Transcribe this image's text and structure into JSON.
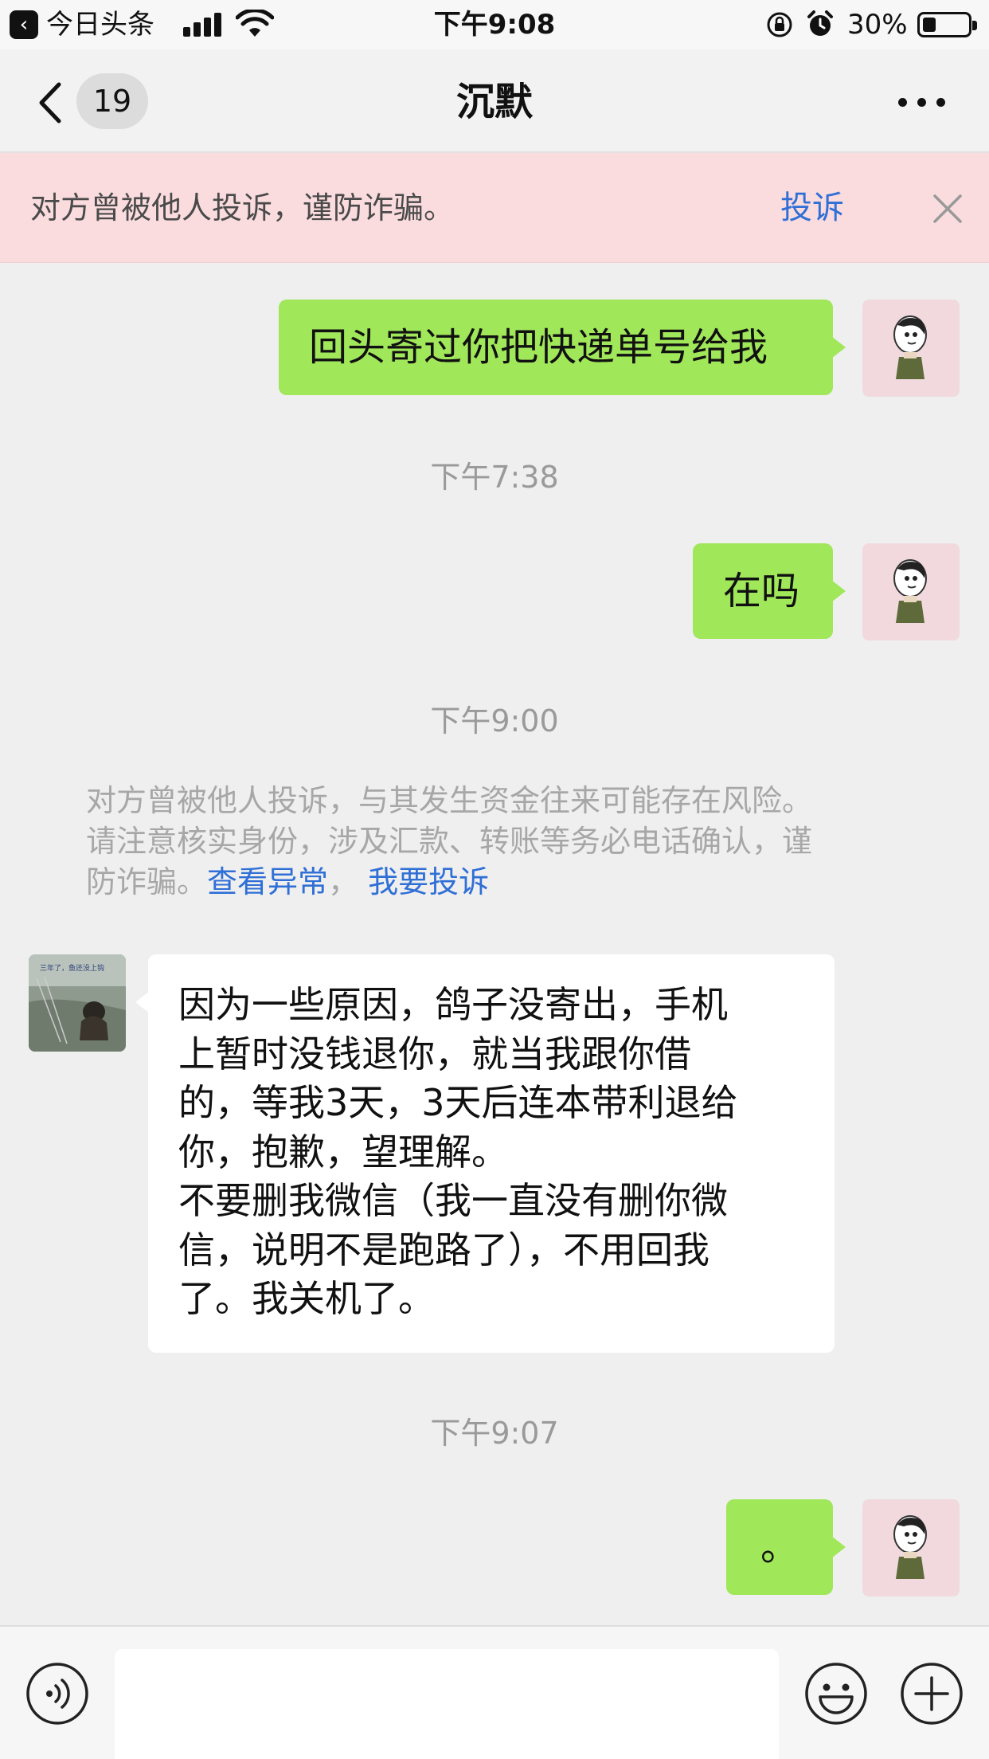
{
  "status_bar": {
    "back_app_label": "今日头条",
    "time": "下午9:08",
    "battery": "30%"
  },
  "nav": {
    "unread_count": "19",
    "title": "沉默"
  },
  "warning_banner": {
    "text": "对方曾被他人投诉，谨防诈骗。",
    "action": "投诉"
  },
  "messages": [
    {
      "type": "sent",
      "text": "回头寄过你把快递单号给我"
    },
    {
      "type": "timestamp",
      "text": "下午7:38"
    },
    {
      "type": "sent",
      "text": "在吗"
    },
    {
      "type": "timestamp",
      "text": "下午9:00"
    },
    {
      "type": "received",
      "lines": [
        "因为一些原因，鸽子没寄出，手机",
        "上暂时没钱退你，就当我跟你借",
        "的，等我3天，3天后连本带利退给",
        "你，抱歉，望理解。",
        "不要删我微信（我一直没有删你微",
        "信，说明不是跑路了），不用回我",
        "了。我关机了。"
      ]
    },
    {
      "type": "timestamp",
      "text": "下午9:07"
    },
    {
      "type": "sent",
      "text": "。"
    }
  ],
  "system_notice": {
    "line1": "对方曾被他人投诉，与其发生资金往来可能存在风险。",
    "line2": "请注意核实身份，涉及汇款、转账等务必电话确认，谨",
    "line3_prefix": "防诈骗。",
    "link_view": "查看异常",
    "separator": "，",
    "link_report": "我要投诉"
  },
  "avatar_caption": "三年了，鱼还没上钩",
  "colors": {
    "sent_bubble": "#a0e75a",
    "received_bubble": "#ffffff",
    "link": "#2f6fd6",
    "warning_bg": "#fadcde",
    "chat_bg": "#efefef"
  },
  "icons": [
    "back-icon",
    "more-icon",
    "close-icon",
    "voice-icon",
    "emoji-icon",
    "plus-icon",
    "signal-icon",
    "wifi-icon",
    "orientation-lock-icon",
    "alarm-icon",
    "battery-icon"
  ]
}
